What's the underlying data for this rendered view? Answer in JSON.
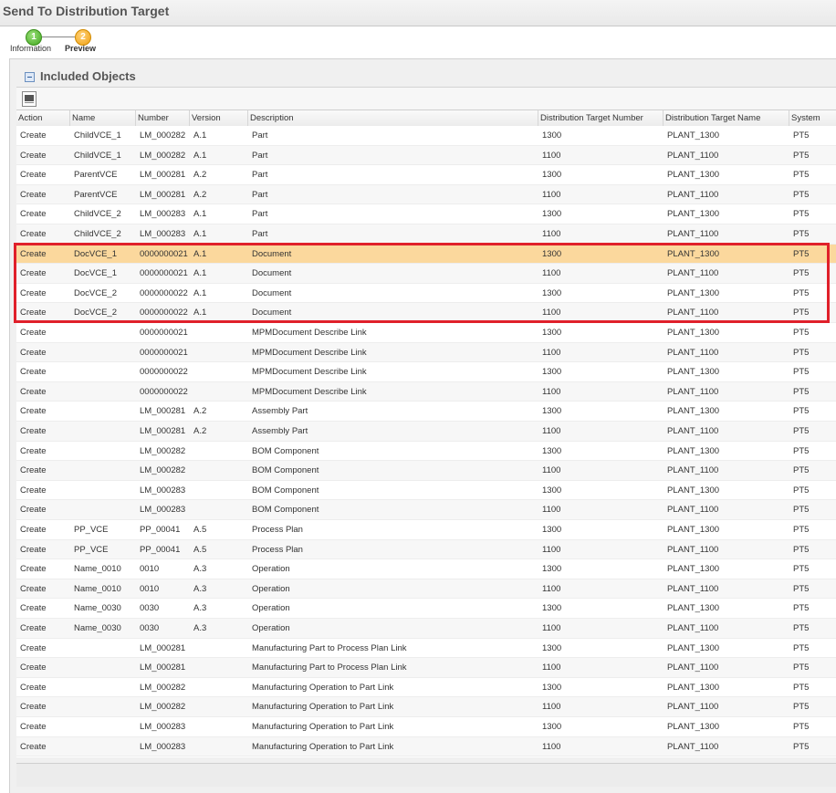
{
  "window": {
    "title": "Send To Distribution Target"
  },
  "steps": [
    {
      "number": "1",
      "label": "Information"
    },
    {
      "number": "2",
      "label": "Preview"
    }
  ],
  "panel": {
    "title": "Included Objects"
  },
  "table": {
    "columns": [
      "Action",
      "Name",
      "Number",
      "Version",
      "Description",
      "Distribution Target Number",
      "Distribution Target Name",
      "System"
    ],
    "selected_row": 6,
    "rows": [
      [
        "Create",
        "ChildVCE_1",
        "LM_000282",
        "A.1",
        "Part",
        "1300",
        "PLANT_1300",
        "PT5"
      ],
      [
        "Create",
        "ChildVCE_1",
        "LM_000282",
        "A.1",
        "Part",
        "1100",
        "PLANT_1100",
        "PT5"
      ],
      [
        "Create",
        "ParentVCE",
        "LM_000281",
        "A.2",
        "Part",
        "1300",
        "PLANT_1300",
        "PT5"
      ],
      [
        "Create",
        "ParentVCE",
        "LM_000281",
        "A.2",
        "Part",
        "1100",
        "PLANT_1100",
        "PT5"
      ],
      [
        "Create",
        "ChildVCE_2",
        "LM_000283",
        "A.1",
        "Part",
        "1300",
        "PLANT_1300",
        "PT5"
      ],
      [
        "Create",
        "ChildVCE_2",
        "LM_000283",
        "A.1",
        "Part",
        "1100",
        "PLANT_1100",
        "PT5"
      ],
      [
        "Create",
        "DocVCE_1",
        "0000000021",
        "A.1",
        "Document",
        "1300",
        "PLANT_1300",
        "PT5"
      ],
      [
        "Create",
        "DocVCE_1",
        "0000000021",
        "A.1",
        "Document",
        "1100",
        "PLANT_1100",
        "PT5"
      ],
      [
        "Create",
        "DocVCE_2",
        "0000000022",
        "A.1",
        "Document",
        "1300",
        "PLANT_1300",
        "PT5"
      ],
      [
        "Create",
        "DocVCE_2",
        "0000000022",
        "A.1",
        "Document",
        "1100",
        "PLANT_1100",
        "PT5"
      ],
      [
        "Create",
        "",
        "0000000021",
        "",
        "MPMDocument Describe Link",
        "1300",
        "PLANT_1300",
        "PT5"
      ],
      [
        "Create",
        "",
        "0000000021",
        "",
        "MPMDocument Describe Link",
        "1100",
        "PLANT_1100",
        "PT5"
      ],
      [
        "Create",
        "",
        "0000000022",
        "",
        "MPMDocument Describe Link",
        "1300",
        "PLANT_1300",
        "PT5"
      ],
      [
        "Create",
        "",
        "0000000022",
        "",
        "MPMDocument Describe Link",
        "1100",
        "PLANT_1100",
        "PT5"
      ],
      [
        "Create",
        "",
        "LM_000281",
        "A.2",
        "Assembly Part",
        "1300",
        "PLANT_1300",
        "PT5"
      ],
      [
        "Create",
        "",
        "LM_000281",
        "A.2",
        "Assembly Part",
        "1100",
        "PLANT_1100",
        "PT5"
      ],
      [
        "Create",
        "",
        "LM_000282",
        "",
        "BOM Component",
        "1300",
        "PLANT_1300",
        "PT5"
      ],
      [
        "Create",
        "",
        "LM_000282",
        "",
        "BOM Component",
        "1100",
        "PLANT_1100",
        "PT5"
      ],
      [
        "Create",
        "",
        "LM_000283",
        "",
        "BOM Component",
        "1300",
        "PLANT_1300",
        "PT5"
      ],
      [
        "Create",
        "",
        "LM_000283",
        "",
        "BOM Component",
        "1100",
        "PLANT_1100",
        "PT5"
      ],
      [
        "Create",
        "PP_VCE",
        "PP_00041",
        "A.5",
        "Process Plan",
        "1300",
        "PLANT_1300",
        "PT5"
      ],
      [
        "Create",
        "PP_VCE",
        "PP_00041",
        "A.5",
        "Process Plan",
        "1100",
        "PLANT_1100",
        "PT5"
      ],
      [
        "Create",
        "Name_0010",
        "0010",
        "A.3",
        "Operation",
        "1300",
        "PLANT_1300",
        "PT5"
      ],
      [
        "Create",
        "Name_0010",
        "0010",
        "A.3",
        "Operation",
        "1100",
        "PLANT_1100",
        "PT5"
      ],
      [
        "Create",
        "Name_0030",
        "0030",
        "A.3",
        "Operation",
        "1300",
        "PLANT_1300",
        "PT5"
      ],
      [
        "Create",
        "Name_0030",
        "0030",
        "A.3",
        "Operation",
        "1100",
        "PLANT_1100",
        "PT5"
      ],
      [
        "Create",
        "",
        "LM_000281",
        "",
        "Manufacturing Part to Process Plan Link",
        "1300",
        "PLANT_1300",
        "PT5"
      ],
      [
        "Create",
        "",
        "LM_000281",
        "",
        "Manufacturing Part to Process Plan Link",
        "1100",
        "PLANT_1100",
        "PT5"
      ],
      [
        "Create",
        "",
        "LM_000282",
        "",
        "Manufacturing Operation to Part Link",
        "1300",
        "PLANT_1300",
        "PT5"
      ],
      [
        "Create",
        "",
        "LM_000282",
        "",
        "Manufacturing Operation to Part Link",
        "1100",
        "PLANT_1100",
        "PT5"
      ],
      [
        "Create",
        "",
        "LM_000283",
        "",
        "Manufacturing Operation to Part Link",
        "1300",
        "PLANT_1300",
        "PT5"
      ],
      [
        "Create",
        "",
        "LM_000283",
        "",
        "Manufacturing Operation to Part Link",
        "1100",
        "PLANT_1100",
        "PT5"
      ]
    ]
  },
  "icons": {
    "collapse": "collapse-icon",
    "export": "export-icon"
  },
  "colors": {
    "selected_row": "#fbd89d",
    "highlight_box": "#e0202a",
    "step_done": "#3fa61d",
    "step_current": "#f0a010"
  }
}
